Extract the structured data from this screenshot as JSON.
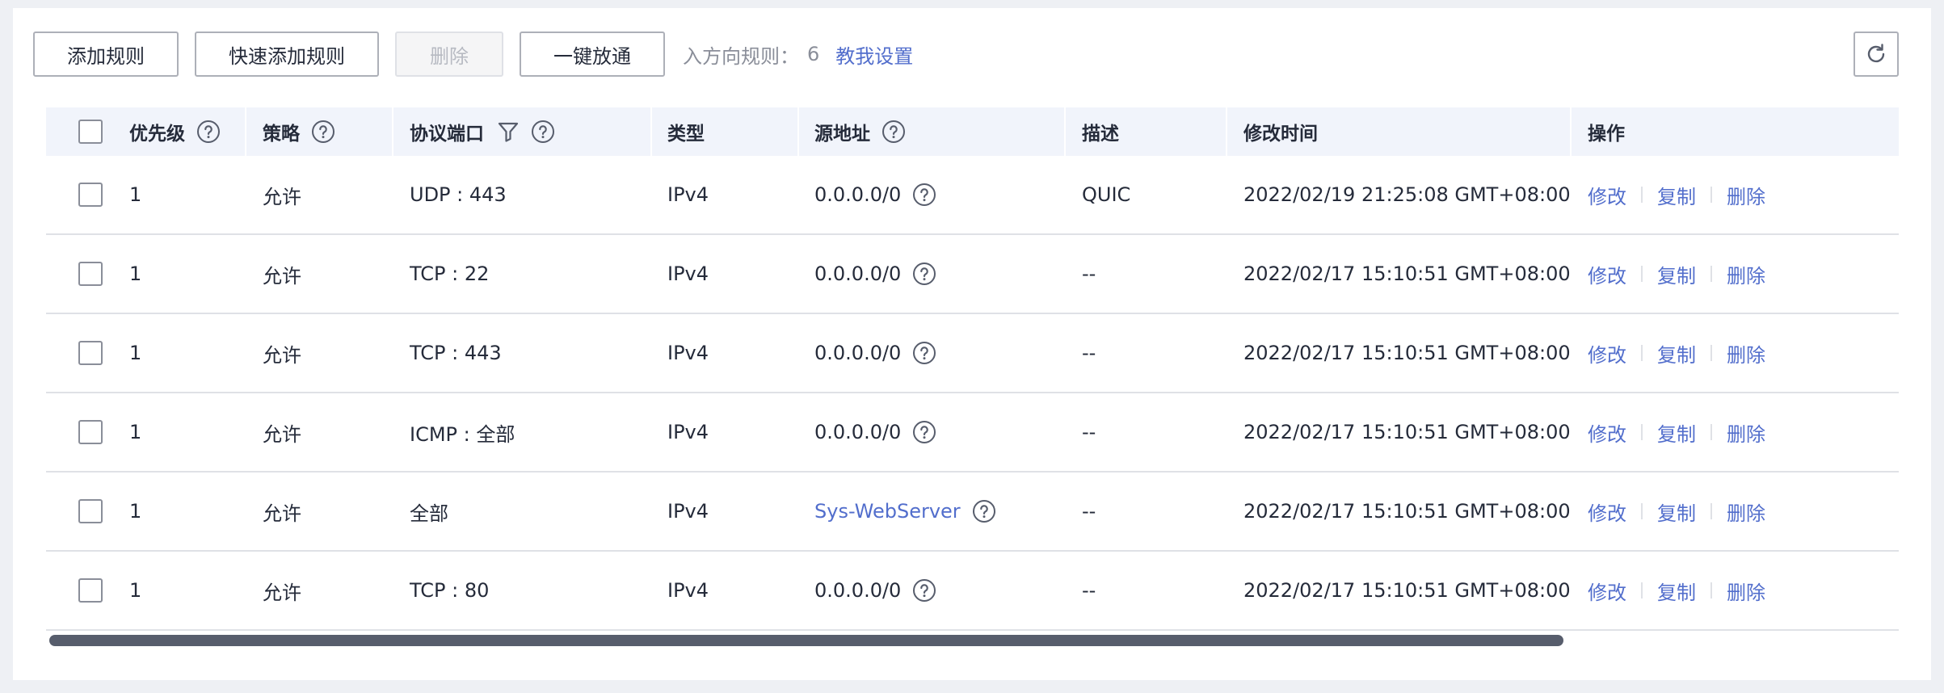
{
  "toolbar": {
    "add_rule": "添加规则",
    "quick_add_rule": "快速添加规则",
    "delete": "删除",
    "one_click_open": "一键放通",
    "inbound_label": "入方向规则：",
    "inbound_count": "6",
    "teach_me": "教我设置"
  },
  "icons": {
    "refresh": "refresh-icon",
    "help": "question-circle-icon",
    "filter": "filter-icon"
  },
  "colors": {
    "link": "#526ecc",
    "header_bg": "#f1f4fb",
    "scrollbar": "#575d6c"
  },
  "table": {
    "headers": {
      "priority": "优先级",
      "policy": "策略",
      "protocol_port": "协议端口",
      "type": "类型",
      "source": "源地址",
      "description": "描述",
      "modified": "修改时间",
      "actions": "操作"
    },
    "actions": {
      "edit": "修改",
      "copy": "复制",
      "delete": "删除"
    },
    "rows": [
      {
        "priority": "1",
        "policy": "允许",
        "protocol": "UDP : 443",
        "type": "IPv4",
        "source": "0.0.0.0/0",
        "source_link": false,
        "description": "QUIC",
        "modified": "2022/02/19 21:25:08 GMT+08:00"
      },
      {
        "priority": "1",
        "policy": "允许",
        "protocol": "TCP : 22",
        "type": "IPv4",
        "source": "0.0.0.0/0",
        "source_link": false,
        "description": "--",
        "modified": "2022/02/17 15:10:51 GMT+08:00"
      },
      {
        "priority": "1",
        "policy": "允许",
        "protocol": "TCP : 443",
        "type": "IPv4",
        "source": "0.0.0.0/0",
        "source_link": false,
        "description": "--",
        "modified": "2022/02/17 15:10:51 GMT+08:00"
      },
      {
        "priority": "1",
        "policy": "允许",
        "protocol": "ICMP : 全部",
        "type": "IPv4",
        "source": "0.0.0.0/0",
        "source_link": false,
        "description": "--",
        "modified": "2022/02/17 15:10:51 GMT+08:00"
      },
      {
        "priority": "1",
        "policy": "允许",
        "protocol": "全部",
        "type": "IPv4",
        "source": "Sys-WebServer",
        "source_link": true,
        "description": "--",
        "modified": "2022/02/17 15:10:51 GMT+08:00"
      },
      {
        "priority": "1",
        "policy": "允许",
        "protocol": "TCP : 80",
        "type": "IPv4",
        "source": "0.0.0.0/0",
        "source_link": false,
        "description": "--",
        "modified": "2022/02/17 15:10:51 GMT+08:00"
      }
    ]
  },
  "scrollbar": {
    "thumb_fraction": 0.82
  }
}
